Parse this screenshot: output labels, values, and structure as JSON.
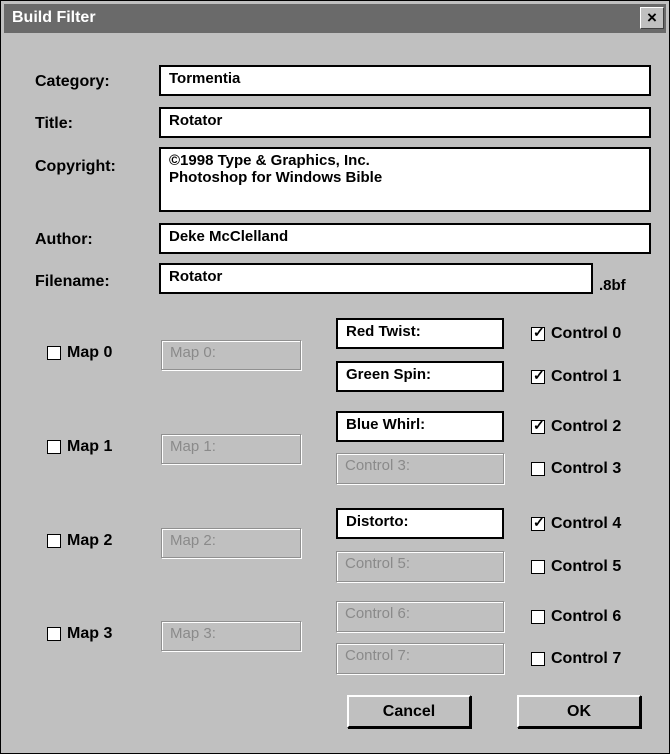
{
  "window": {
    "title": "Build Filter",
    "close_label": "×"
  },
  "fields": {
    "category": {
      "label": "Category:",
      "value": "Tormentia"
    },
    "title": {
      "label": "Title:",
      "value": "Rotator"
    },
    "copyright": {
      "label": "Copyright:",
      "value": "©1998 Type & Graphics, Inc.\nPhotoshop for Windows Bible"
    },
    "author": {
      "label": "Author:",
      "value": "Deke McClelland"
    },
    "filename": {
      "label": "Filename:",
      "value": "Rotator",
      "suffix": ".8bf"
    }
  },
  "maps": [
    {
      "label": "Map 0",
      "checked": false,
      "placeholder": "Map 0:"
    },
    {
      "label": "Map 1",
      "checked": false,
      "placeholder": "Map 1:"
    },
    {
      "label": "Map 2",
      "checked": false,
      "placeholder": "Map 2:"
    },
    {
      "label": "Map 3",
      "checked": false,
      "placeholder": "Map 3:"
    }
  ],
  "controls": [
    {
      "field": "Red Twist:",
      "enabled": true,
      "label": "Control 0",
      "checked": true
    },
    {
      "field": "Green Spin:",
      "enabled": true,
      "label": "Control 1",
      "checked": true
    },
    {
      "field": "Blue Whirl:",
      "enabled": true,
      "label": "Control 2",
      "checked": true
    },
    {
      "field": "Control 3:",
      "enabled": false,
      "label": "Control 3",
      "checked": false
    },
    {
      "field": "Distorto:",
      "enabled": true,
      "label": "Control 4",
      "checked": true
    },
    {
      "field": "Control 5:",
      "enabled": false,
      "label": "Control 5",
      "checked": false
    },
    {
      "field": "Control 6:",
      "enabled": false,
      "label": "Control 6",
      "checked": false
    },
    {
      "field": "Control 7:",
      "enabled": false,
      "label": "Control 7",
      "checked": false
    }
  ],
  "buttons": {
    "cancel": "Cancel",
    "ok": "OK"
  }
}
